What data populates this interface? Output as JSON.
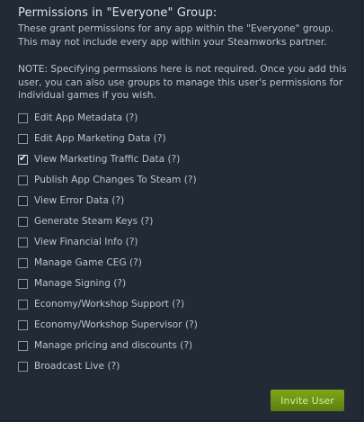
{
  "header": {
    "title": "Permissions in \"Everyone\" Group:",
    "description": "These grant permissions for any app within the \"Everyone\" group. This may not include every app within your Steamworks partner.",
    "note": "NOTE: Specifying permssions here is not required. Once you add this user, you can also use groups to manage this user's permissions for individual games if you wish."
  },
  "permissions": [
    {
      "label": "Edit App Metadata (?)",
      "checked": false
    },
    {
      "label": "Edit App Marketing Data (?)",
      "checked": false
    },
    {
      "label": "View Marketing Traffic Data (?)",
      "checked": true
    },
    {
      "label": "Publish App Changes To Steam (?)",
      "checked": false
    },
    {
      "label": "View Error Data (?)",
      "checked": false
    },
    {
      "label": "Generate Steam Keys (?)",
      "checked": false
    },
    {
      "label": "View Financial Info (?)",
      "checked": false
    },
    {
      "label": "Manage Game CEG (?)",
      "checked": false
    },
    {
      "label": "Manage Signing (?)",
      "checked": false
    },
    {
      "label": "Economy/Workshop Support (?)",
      "checked": false
    },
    {
      "label": "Economy/Workshop Supervisor (?)",
      "checked": false
    },
    {
      "label": "Manage pricing and discounts (?)",
      "checked": false
    },
    {
      "label": "Broadcast Live (?)",
      "checked": false
    }
  ],
  "checkmark_glyph": "✔",
  "invite_button": {
    "label": "Invite User"
  }
}
